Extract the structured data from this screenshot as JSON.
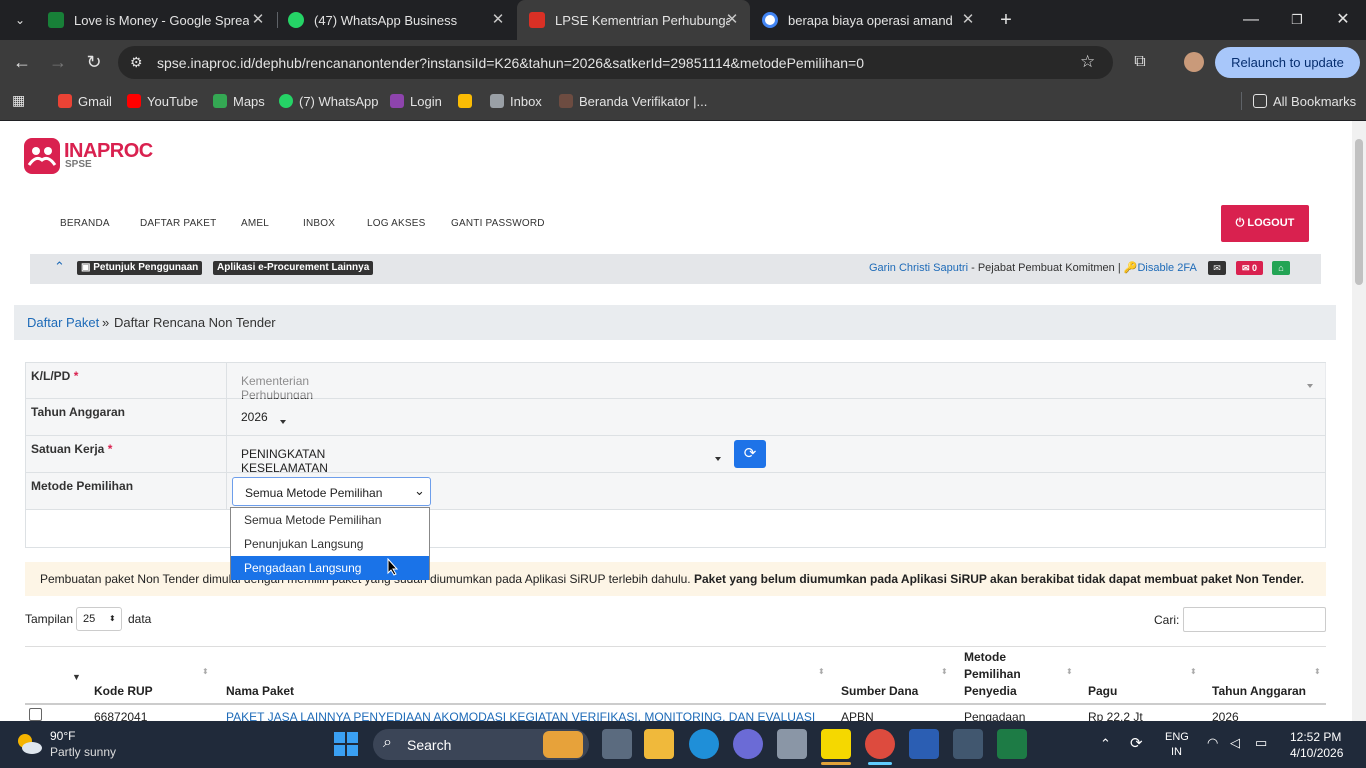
{
  "browser": {
    "tabs": [
      {
        "title": "Love is Money - Google Spread",
        "color": "#188038"
      },
      {
        "title": "(47) WhatsApp Business",
        "color": "#25d366"
      },
      {
        "title": "LPSE Kementrian Perhubungan",
        "color": "#d93025"
      },
      {
        "title": "berapa biaya operasi amandel -",
        "color": "#4285f4"
      }
    ],
    "url": "spse.inaproc.id/dephub/rencananontender?instansiId=K26&tahun=2026&satkerId=29851114&metodePemilihan=0",
    "relaunch": "Relaunch to update",
    "bookmarks": [
      "Gmail",
      "YouTube",
      "Maps",
      "(7) WhatsApp",
      "Login",
      "Inbox",
      "Beranda Verifikator |...",
      "All Bookmarks"
    ]
  },
  "site": {
    "logo": "INAPROC",
    "logo_sub": "SPSE",
    "nav": [
      "BERANDA",
      "DAFTAR PAKET",
      "AMEL",
      "INBOX",
      "LOG AKSES",
      "GANTI PASSWORD"
    ],
    "logout": "LOGOUT",
    "info_labels": [
      "Petunjuk Penggunaan",
      "Aplikasi e-Procurement Lainnya"
    ],
    "user": "Garin Christi Saputri",
    "role": " - Pejabat Pembuat Komitmen | ",
    "disable_2fa": "Disable 2FA",
    "mail_count": "0"
  },
  "breadcrumb": {
    "link": "Daftar Paket",
    "sep": "»",
    "current": "Daftar Rencana Non Tender"
  },
  "form": {
    "klpd_label": "K/L/PD",
    "klpd_value": "Kementerian Perhubungan",
    "tahun_label": "Tahun Anggaran",
    "tahun_value": "2026",
    "satker_label": "Satuan Kerja",
    "satker_value": "PENINGKATAN KESELAMATAN LALU LINTAS ANGKUTAN LAUT PUSAT",
    "metode_label": "Metode Pemilihan",
    "metode_value": "Semua Metode Pemilihan",
    "required": "*",
    "options": [
      "Semua Metode Pemilihan",
      "Penunjukan Langsung",
      "Pengadaan Langsung"
    ]
  },
  "notice": {
    "text": "Pembuatan paket Non Tender dimulai dengan memilih paket yang sudah diumumkan pada Aplikasi SiRUP terlebih dahulu.",
    "bold": "Paket yang belum diumumkan pada Aplikasi SiRUP akan berakibat tidak dapat membuat paket Non Tender."
  },
  "table_controls": {
    "show_label": "Tampilan",
    "show_value": "25",
    "show_suffix": "data",
    "search_label": "Cari:"
  },
  "table": {
    "headers": [
      "Kode RUP",
      "Nama Paket",
      "Sumber Dana",
      "Metode Pemilihan Penyedia",
      "Pagu",
      "Tahun Anggaran"
    ],
    "rows": [
      {
        "kode": "66872041",
        "nama": "PAKET JASA LAINNYA PENYEDIAAN AKOMODASI KEGIATAN VERIFIKASI, MONITORING, DAN EVALUASI",
        "sumber": "APBN",
        "metode": "Pengadaan",
        "pagu": "Rp 22,2 Jt",
        "tahun": "2026"
      }
    ]
  },
  "taskbar": {
    "weather_temp": "90°F",
    "weather_desc": "Partly sunny",
    "search": "Search",
    "lang1": "ENG",
    "lang2": "IN",
    "time": "12:52 PM",
    "date": "4/10/2026"
  }
}
